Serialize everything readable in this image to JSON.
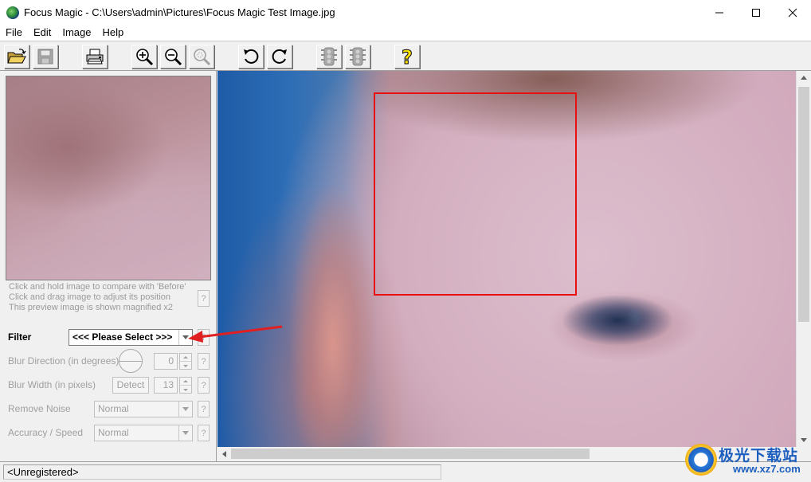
{
  "window": {
    "title": "Focus Magic - C:\\Users\\admin\\Pictures\\Focus Magic Test Image.jpg",
    "controls": [
      "minimize-icon",
      "maximize-icon",
      "close-icon"
    ]
  },
  "menu": [
    "File",
    "Edit",
    "Image",
    "Help"
  ],
  "toolbar": {
    "buttons": [
      "open-folder-icon",
      "save-disk-icon",
      "print-icon",
      "zoom-in-icon",
      "zoom-out-icon",
      "zoom-fit-icon",
      "rotate-left-icon",
      "rotate-right-icon",
      "traffic-light-icon",
      "traffic-light-icon",
      "help-question-icon"
    ],
    "disabled": [
      "save-disk-icon",
      "zoom-fit-icon",
      "traffic-light-icon"
    ],
    "help_label": "?"
  },
  "preview": {
    "hint_1": "Click and hold image to compare with 'Before'",
    "hint_2": "Click and drag image to adjust its position",
    "hint_3": "This preview image is shown magnified x2",
    "help_label": "?"
  },
  "controls": {
    "filter_label": "Filter",
    "filter_value": "<<< Please Select >>>",
    "blur_direction_label": "Blur Direction (in degrees)",
    "blur_direction_value": "0",
    "blur_width_label": "Blur Width (in pixels)",
    "detect_label": "Detect",
    "blur_width_value": "13",
    "remove_noise_label": "Remove Noise",
    "remove_noise_value": "Normal",
    "accuracy_label": "Accuracy / Speed",
    "accuracy_value": "Normal",
    "help_label": "?"
  },
  "status": {
    "text": "<Unregistered>"
  },
  "watermark": {
    "main": "极光下载站",
    "sub": "www.xz7.com"
  },
  "colors": {
    "focus_rect": "#e81010",
    "annotation_arrow": "#e02020",
    "help_icon": "#ffe600"
  }
}
